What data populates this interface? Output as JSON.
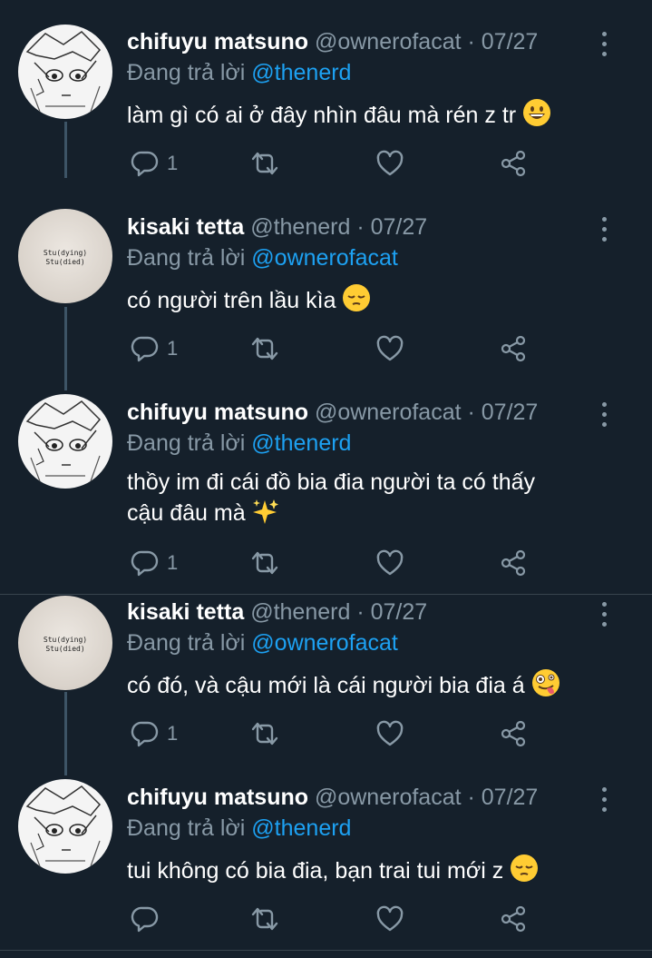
{
  "reply_prefix": "Đang trả lời",
  "tweets": [
    {
      "name": "chifuyu matsuno",
      "handle": "@ownerofacat",
      "date": "· 07/27",
      "reply_to": "@thenerd",
      "text": "làm gì có ai ở đây nhìn đâu mà rén z tr",
      "emoji": "grinning-face",
      "replies": "1",
      "avatar": "manga"
    },
    {
      "name": "kisaki tetta",
      "handle": "@thenerd",
      "date": "· 07/27",
      "reply_to": "@ownerofacat",
      "text": "có người trên lầu kìa",
      "emoji": "pensive-face",
      "replies": "1",
      "avatar": "shirt"
    },
    {
      "name": "chifuyu matsuno",
      "handle": "@ownerofacat",
      "date": "· 07/27",
      "reply_to": "@thenerd",
      "text_line1": "thồy im đi cái đồ bia đia người ta có thấy",
      "text_line2": "cậu đâu mà",
      "emoji": "sparkles",
      "replies": "1",
      "avatar": "manga"
    },
    {
      "name": "kisaki tetta",
      "handle": "@thenerd",
      "date": "· 07/27",
      "reply_to": "@ownerofacat",
      "text": "có đó, và cậu mới là cái người bia đia á",
      "emoji": "zany-face",
      "replies": "1",
      "avatar": "shirt"
    },
    {
      "name": "chifuyu matsuno",
      "handle": "@ownerofacat",
      "date": "· 07/27",
      "reply_to": "@thenerd",
      "text": "tui không có bia đia, bạn trai tui mới z",
      "emoji": "pensive-face",
      "replies": "",
      "avatar": "manga"
    }
  ],
  "shirt_print": {
    "line1": "Stu(dying)",
    "line2": "Stu(died)"
  },
  "colors": {
    "background": "#15202b",
    "mention": "#1da1f2",
    "muted": "#8899a6",
    "thread_line": "#3d5466"
  }
}
